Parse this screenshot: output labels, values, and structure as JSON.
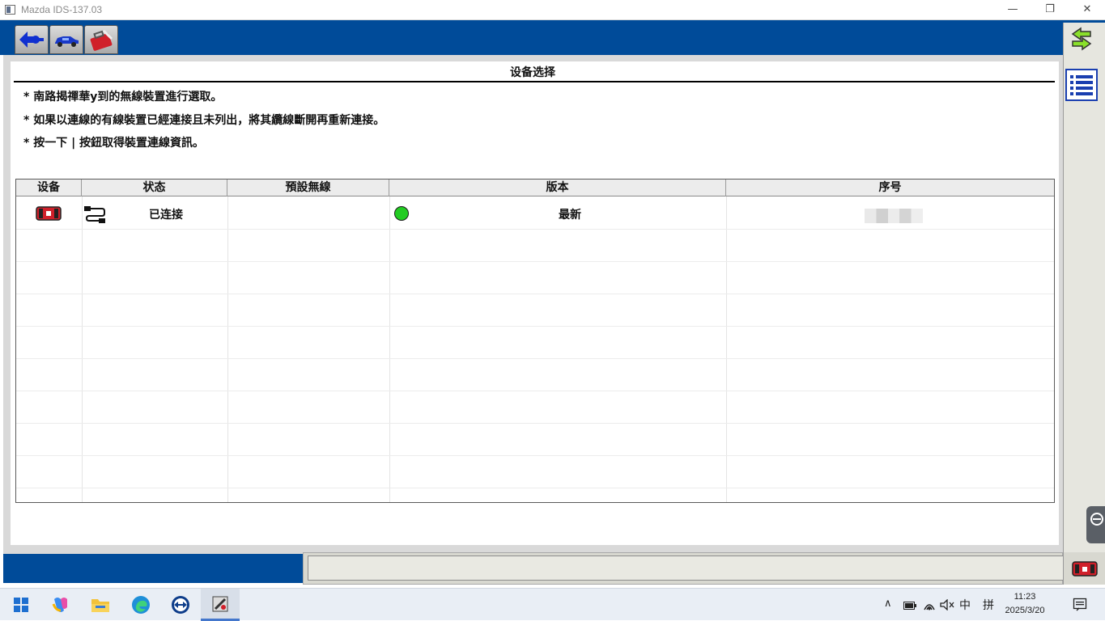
{
  "window": {
    "title": "Mazda IDS-137.03",
    "minimize_glyph": "—",
    "restore_glyph": "❐",
    "close_glyph": "✕"
  },
  "toolbar": {
    "buttons": [
      {
        "name": "connection-arrow-icon"
      },
      {
        "name": "vehicle-icon"
      },
      {
        "name": "toolbox-icon"
      }
    ]
  },
  "side_rail": {
    "buttons": [
      {
        "name": "switch-arrows-icon"
      },
      {
        "name": "list-icon"
      }
    ]
  },
  "section": {
    "title": "设备选择"
  },
  "instructions": [
    "* 南路揭禪華y到的無線裝置進行選取。",
    "* 如果以連線的有線裝置已經連接且未列出，將其纜線斷開再重新連接。",
    "* 按一下 | 按鈕取得裝置連線資訊。"
  ],
  "table": {
    "columns": [
      "设备",
      "状态",
      "預設無線",
      "版本",
      "序号"
    ],
    "rows": [
      {
        "device_icon": "vci-device-icon",
        "status_icon": "wired-connection-icon",
        "status": "已连接",
        "default_wireless": "",
        "version_indicator": "green",
        "version": "最新",
        "serial": ""
      }
    ]
  },
  "taskbar": {
    "tray_ime": "中",
    "tray_keyboard": "拼",
    "time": "11:23",
    "date": "2025/3/20"
  },
  "colors": {
    "chrome_blue": "#004b99",
    "status_green": "#22cc22",
    "device_red": "#d0202a"
  }
}
